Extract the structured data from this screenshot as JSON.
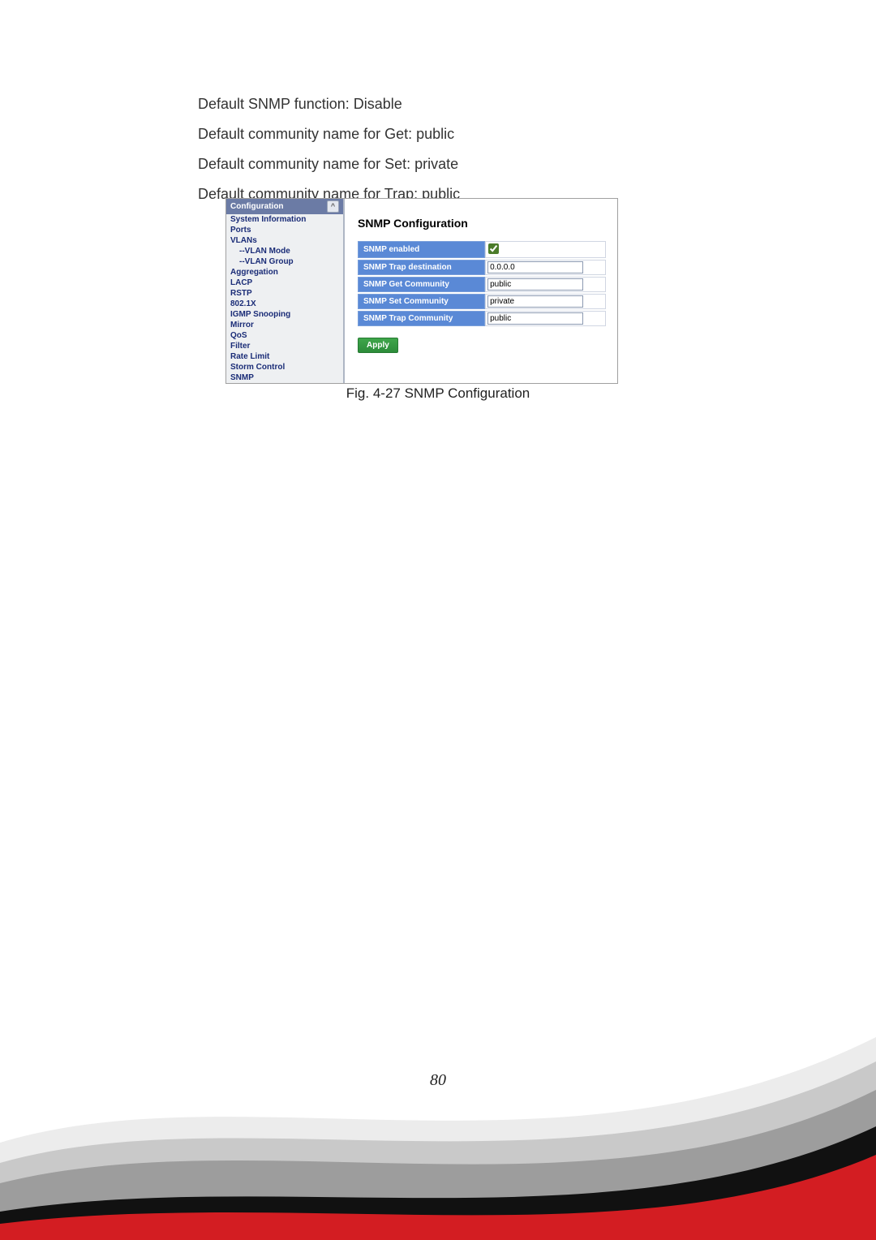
{
  "body_text": {
    "line1": "Default SNMP function: Disable",
    "line2": "Default community name for Get: public",
    "line3": "Default community name for Set: private",
    "line4": "Default community name for Trap: public"
  },
  "sidebar": {
    "header": "Configuration",
    "items": [
      "System Information",
      "Ports",
      "VLANs",
      "--VLAN Mode",
      "--VLAN Group",
      "Aggregation",
      "LACP",
      "RSTP",
      "802.1X",
      "IGMP Snooping",
      "Mirror",
      "QoS",
      "Filter",
      "Rate Limit",
      "Storm Control",
      "SNMP"
    ]
  },
  "main": {
    "heading": "SNMP Configuration",
    "rows": {
      "enabled_label": "SNMP enabled",
      "trap_dest_label": "SNMP Trap destination",
      "trap_dest_value": "0.0.0.0",
      "get_comm_label": "SNMP Get Community",
      "get_comm_value": "public",
      "set_comm_label": "SNMP Set Community",
      "set_comm_value": "private",
      "trap_comm_label": "SNMP Trap Community",
      "trap_comm_value": "public"
    },
    "apply": "Apply"
  },
  "caption": "Fig. 4-27 SNMP Configuration",
  "page_number": "80"
}
